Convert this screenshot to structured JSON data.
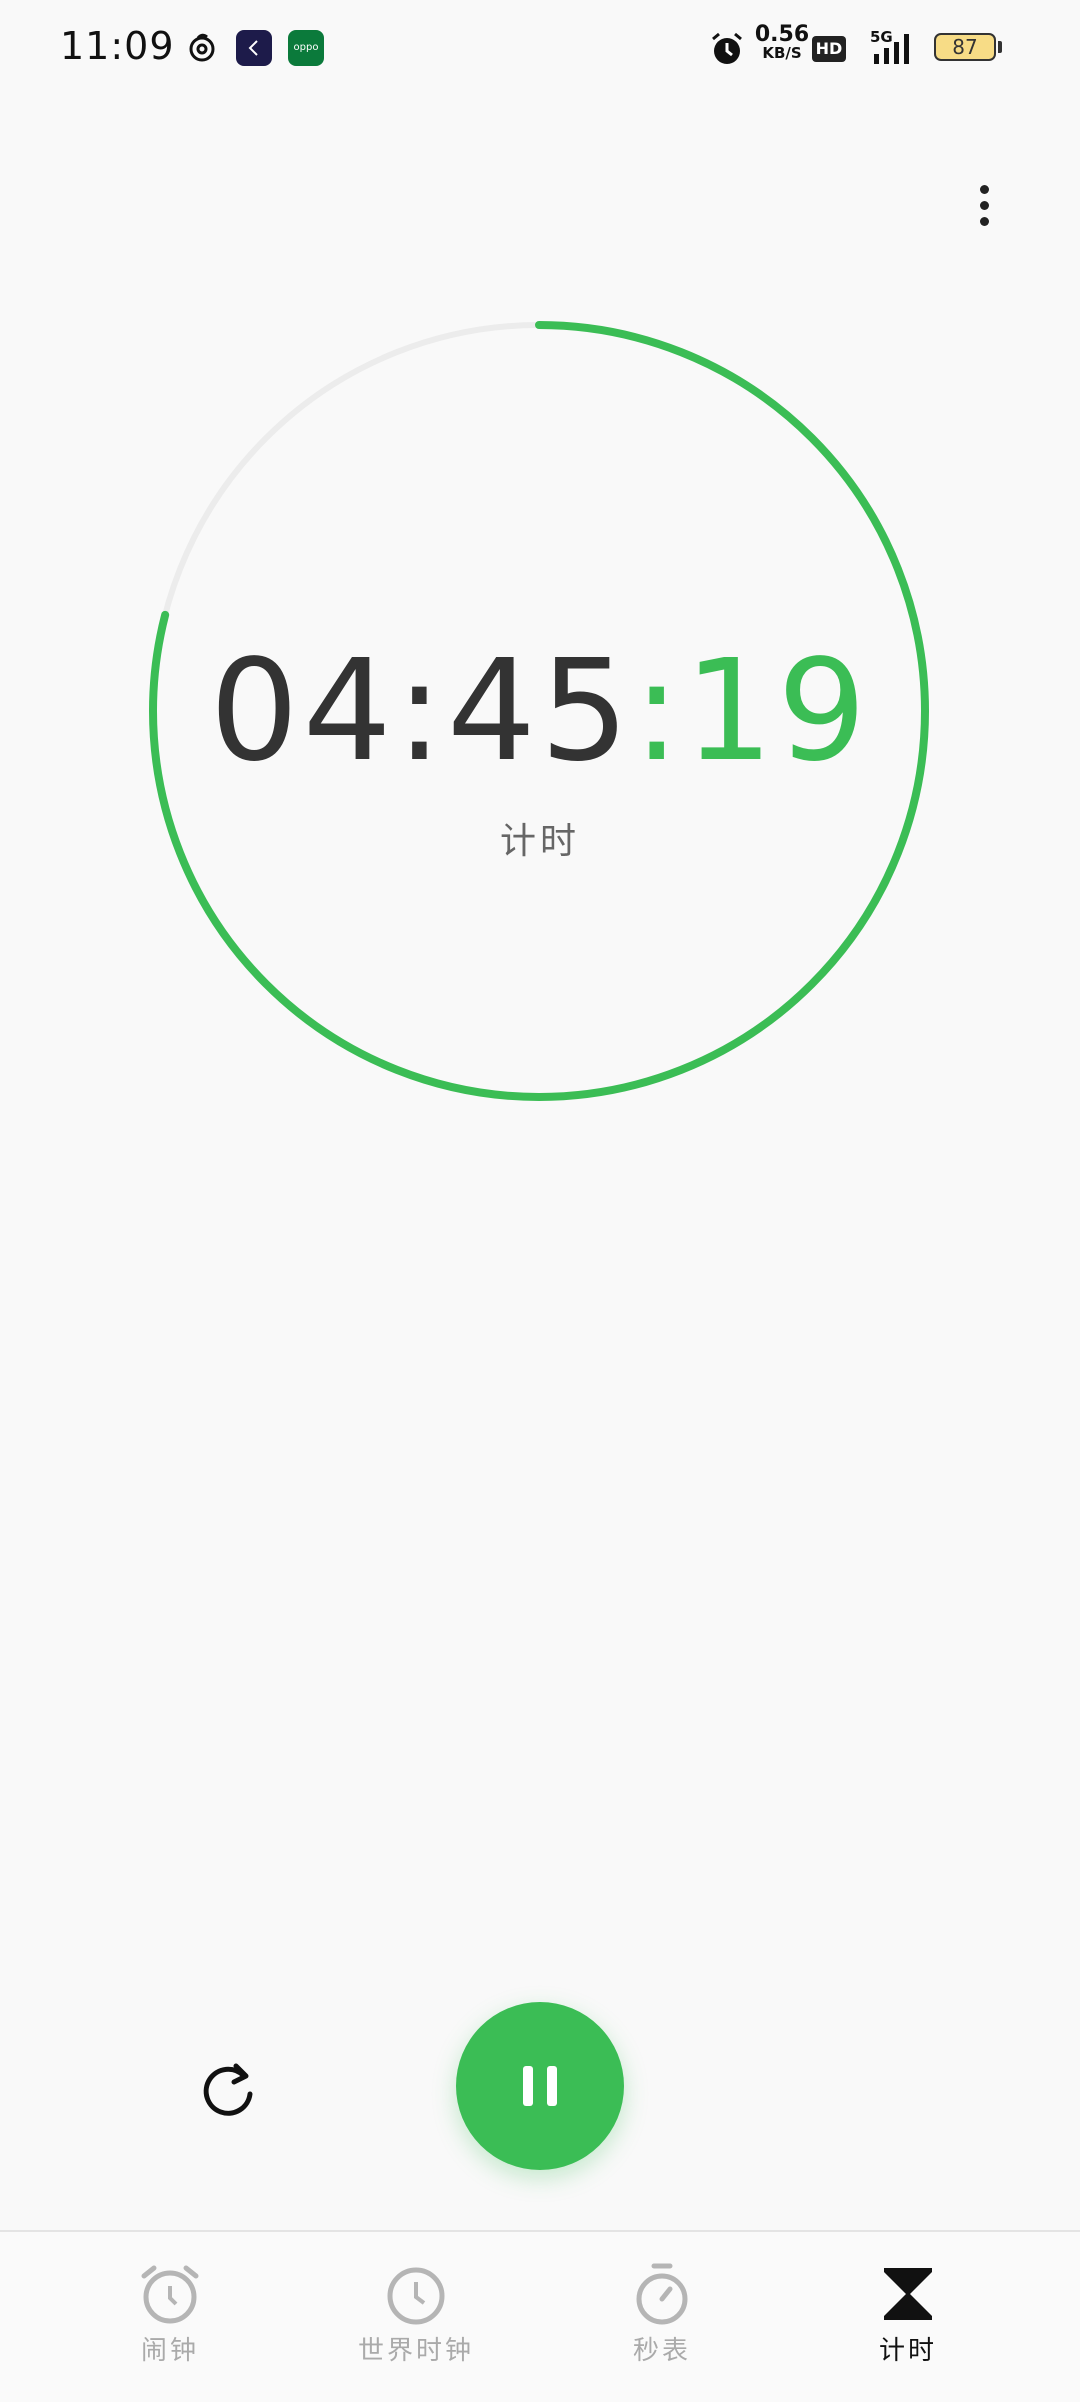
{
  "status_bar": {
    "time": "11:09",
    "net_speed_value": "0.56",
    "net_speed_unit": "KB/S",
    "hd_label": "HD",
    "network_label": "5G",
    "battery_level": "87",
    "app_icons": [
      "netease-music-icon",
      "back-app-icon",
      "oppo-app-icon"
    ],
    "oppo_label": "oppo"
  },
  "timer": {
    "hours_minutes": "04:45",
    "seconds": ":19",
    "label": "计时",
    "progress_remaining_fraction": 0.79,
    "ring_color": "#3bbd55",
    "track_color": "#ececec"
  },
  "controls": {
    "reset_icon": "reset-icon",
    "pause_icon": "pause-icon",
    "accent": "#3bbd55"
  },
  "bottom_nav": {
    "items": [
      {
        "label": "闹钟",
        "icon": "alarm-clock-icon",
        "active": false
      },
      {
        "label": "世界时钟",
        "icon": "world-clock-icon",
        "active": false
      },
      {
        "label": "秒表",
        "icon": "stopwatch-icon",
        "active": false
      },
      {
        "label": "计时",
        "icon": "hourglass-icon",
        "active": true
      }
    ]
  }
}
